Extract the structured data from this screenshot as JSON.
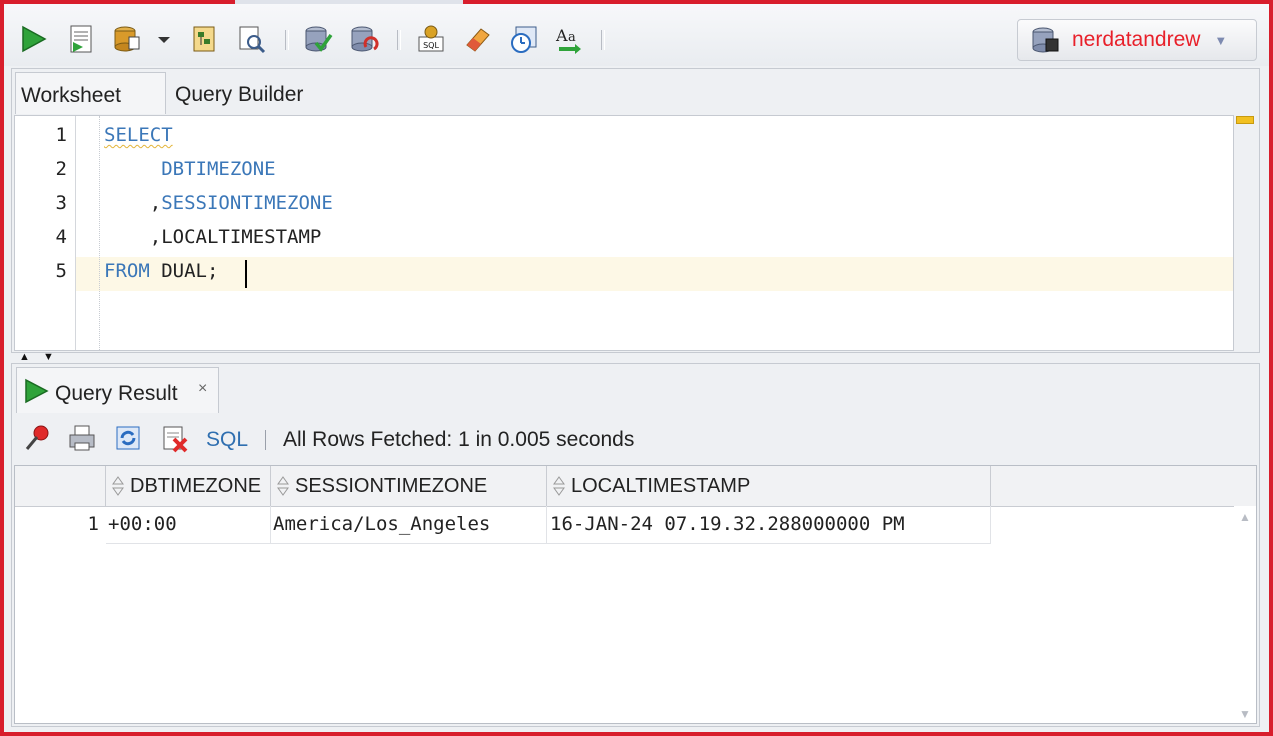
{
  "toolbar": {
    "buttons": [
      "run-statement-icon",
      "run-script-icon",
      "commit-icon",
      "rollback-icon",
      "explain-plan-icon",
      "autotrace-icon",
      "sql-tuning-icon",
      "clear-icon",
      "sql-history-icon",
      "unshared-worksheet-icon",
      "eraser-icon",
      "format-icon"
    ],
    "connection": "nerdatandrew"
  },
  "editor": {
    "tabs": [
      "Worksheet",
      "Query Builder"
    ],
    "line_numbers": [
      "1",
      "2",
      "3",
      "4",
      "5"
    ],
    "lines": [
      {
        "parts": [
          {
            "text": "SELECT",
            "kw": true
          }
        ]
      },
      {
        "parts": [
          {
            "text": "     ",
            "kw": false
          },
          {
            "text": "DBTIMEZONE",
            "kw": true
          }
        ]
      },
      {
        "parts": [
          {
            "text": "    ,",
            "kw": false
          },
          {
            "text": "SESSIONTIMEZONE",
            "kw": true
          }
        ]
      },
      {
        "parts": [
          {
            "text": "    ,LOCALTIMESTAMP",
            "kw": false
          }
        ]
      },
      {
        "parts": [
          {
            "text": "FROM",
            "kw": true
          },
          {
            "text": " DUAL;",
            "kw": false
          }
        ]
      }
    ]
  },
  "result": {
    "tab_label": "Query Result",
    "tab_close": "×",
    "sql_label": "SQL",
    "separator": "|",
    "status": "All Rows Fetched: 1 in 0.005 seconds",
    "columns": [
      "DBTIMEZONE",
      "SESSIONTIMEZONE",
      "LOCALTIMESTAMP"
    ],
    "rows": [
      {
        "num": "1",
        "cells": [
          "+00:00",
          "America/Los_Angeles",
          "16-JAN-24 07.19.32.288000000 PM"
        ]
      }
    ]
  },
  "colors": {
    "frame": "#d81e2c",
    "keyword": "#3b77b8",
    "connection": "#e8202a",
    "sql_link": "#2f6fb0"
  }
}
